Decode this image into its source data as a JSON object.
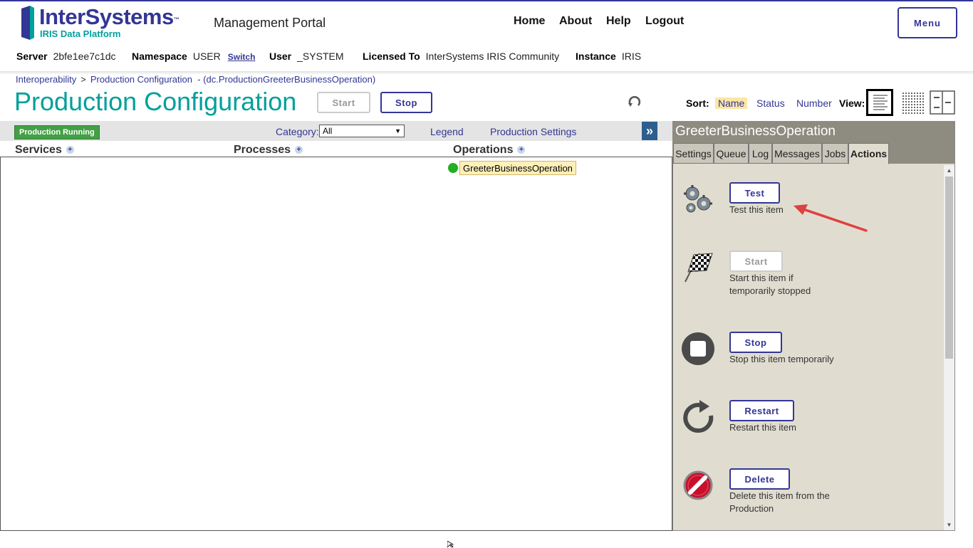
{
  "header": {
    "logo_name": "InterSystems",
    "logo_tm": "™",
    "logo_sub": "IRIS Data Platform",
    "portal_title": "Management Portal",
    "nav": [
      "Home",
      "About",
      "Help",
      "Logout"
    ],
    "menu_label": "Menu",
    "brand_color": "#333695",
    "accent_color": "#00a09b"
  },
  "info": {
    "server_label": "Server",
    "server_value": "2bfe1ee7c1dc",
    "namespace_label": "Namespace",
    "namespace_value": "USER",
    "switch_label": "Switch",
    "user_label": "User",
    "user_value": "_SYSTEM",
    "licensed_label": "Licensed To",
    "licensed_value": "InterSystems IRIS Community",
    "instance_label": "Instance",
    "instance_value": "IRIS"
  },
  "breadcrumb": {
    "item1": "Interoperability",
    "separator": ">",
    "item2": "Production Configuration",
    "suffix": "- (dc.ProductionGreeterBusinessOperation)"
  },
  "page": {
    "title": "Production Configuration",
    "start_label": "Start",
    "stop_label": "Stop"
  },
  "sort": {
    "label": "Sort:",
    "options": [
      "Name",
      "Status",
      "Number"
    ],
    "selected": "Name",
    "view_label": "View:"
  },
  "toolbar": {
    "status_badge": "Production Running",
    "category_label": "Category:",
    "category_value": "All",
    "legend_link": "Legend",
    "settings_link": "Production Settings",
    "expand_glyph": "»"
  },
  "columns": {
    "services": "Services",
    "processes": "Processes",
    "operations": "Operations",
    "add_glyph": "+"
  },
  "operations_items": [
    {
      "name": "GreeterBusinessOperation",
      "status_color": "#22b022"
    }
  ],
  "panel": {
    "title": "GreeterBusinessOperation",
    "tabs": [
      "Settings",
      "Queue",
      "Log",
      "Messages",
      "Jobs",
      "Actions"
    ],
    "active_tab": "Actions",
    "actions": [
      {
        "button": "Test",
        "desc": "Test this item",
        "icon": "gears-icon",
        "enabled": true
      },
      {
        "button": "Start",
        "desc": "Start this item if temporarily stopped",
        "icon": "checkered-flag-icon",
        "enabled": false
      },
      {
        "button": "Stop",
        "desc": "Stop this item temporarily",
        "icon": "stop-icon",
        "enabled": true
      },
      {
        "button": "Restart",
        "desc": "Restart this item",
        "icon": "restart-icon",
        "enabled": true
      },
      {
        "button": "Delete",
        "desc": "Delete this item from the Production",
        "icon": "delete-icon",
        "enabled": true
      }
    ]
  }
}
